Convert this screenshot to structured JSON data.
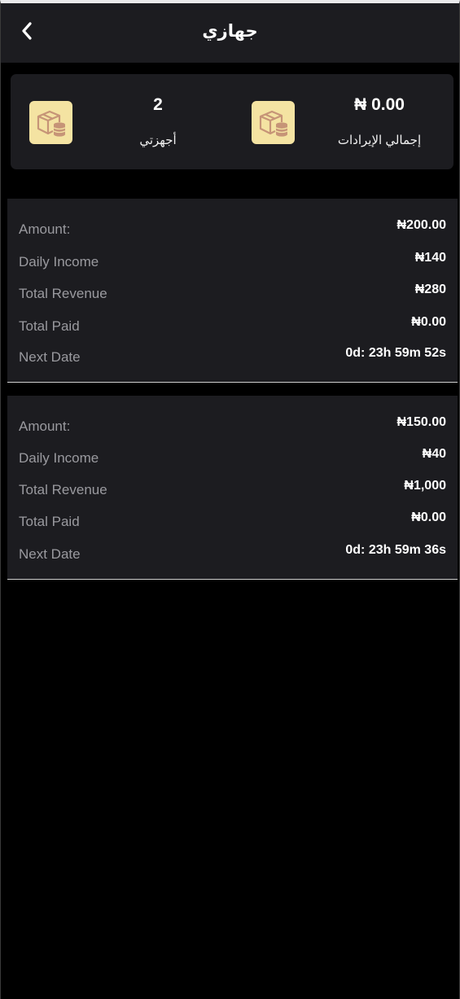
{
  "header": {
    "title": "جهازي",
    "back_icon": "chevron-left-icon"
  },
  "summary": {
    "total_revenue": {
      "value": "₦ 0.00",
      "label": "إجمالي الإيرادات",
      "icon": "box-coins-icon"
    },
    "my_devices": {
      "value": "2",
      "label": "أجهزتي",
      "icon": "box-coins-icon"
    }
  },
  "cards": [
    {
      "rows": [
        {
          "label": "Amount:",
          "value": "₦200.00"
        },
        {
          "label": "Daily Income",
          "value": "₦140"
        },
        {
          "label": "Total Revenue",
          "value": "₦280"
        },
        {
          "label": "Total Paid",
          "value": "₦0.00"
        },
        {
          "label": "Next Date",
          "value": "0d: 23h 59m 52s"
        }
      ]
    },
    {
      "rows": [
        {
          "label": "Amount:",
          "value": "₦150.00"
        },
        {
          "label": "Daily Income",
          "value": "₦40"
        },
        {
          "label": "Total Revenue",
          "value": "₦1,000"
        },
        {
          "label": "Total Paid",
          "value": "₦0.00"
        },
        {
          "label": "Next Date",
          "value": "0d: 23h 59m 36s"
        }
      ]
    }
  ],
  "colors": {
    "background": "#000000",
    "panel": "#1c1c20",
    "icon_bg": "#f4e3a2",
    "icon_fg": "#c69477",
    "muted_text": "#9a9a9f"
  }
}
